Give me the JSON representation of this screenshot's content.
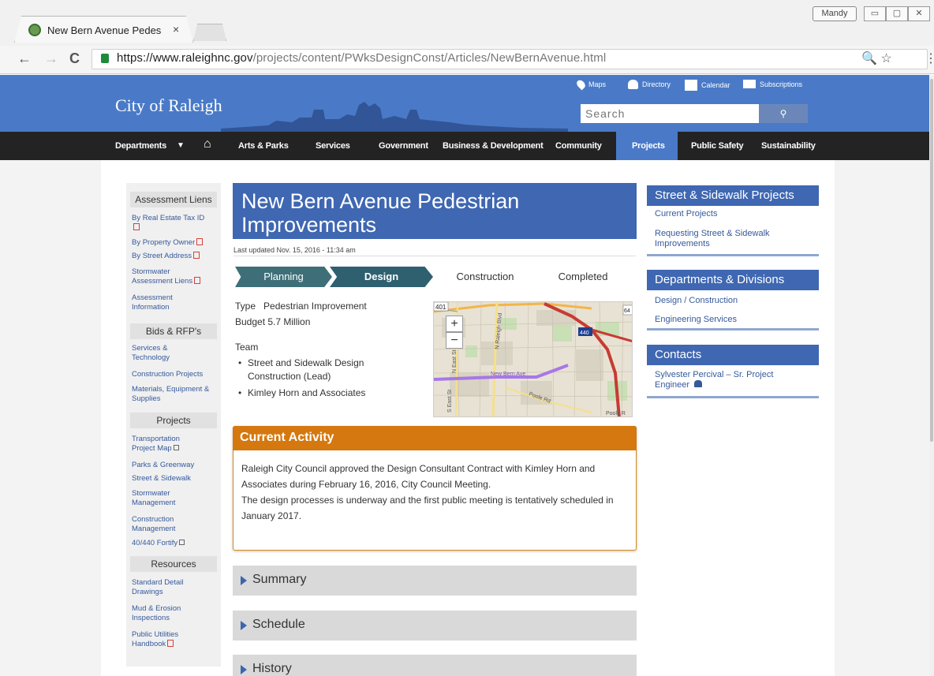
{
  "browser": {
    "tab_title": "New Bern Avenue Pedes",
    "tab_close": "×",
    "user": "Mandy",
    "url_host": "https://www.raleighnc.gov",
    "url_path": "/projects/content/PWksDesignConst/Articles/NewBernAvenue.html",
    "win_buttons": [
      "▭",
      "▢",
      "✕"
    ],
    "nav_back": "←",
    "nav_forward": "→",
    "nav_reload": "C",
    "url_icons": "🔍 ☆",
    "menu": "⋮"
  },
  "site": {
    "logo": "City of Raleigh",
    "util_links": [
      "Maps",
      "Directory",
      "Calendar",
      "Subscriptions"
    ],
    "search_placeholder": "Search",
    "search_icon": "⚲"
  },
  "nav": {
    "departments": "Departments",
    "caret": "▼",
    "home_icon": "⌂",
    "items": [
      "Arts & Parks",
      "Services",
      "Government",
      "Business & Development",
      "Community",
      "Projects",
      "Public Safety",
      "Sustainability"
    ]
  },
  "left_sidebar": {
    "sections": [
      {
        "heading": "Assessment Liens",
        "links": [
          "By Real Estate Tax ID",
          "By Property Owner",
          "By Street Address",
          "Stormwater Assessment Liens",
          "Assessment Information"
        ]
      },
      {
        "heading": "Bids & RFP's",
        "links": [
          "Services & Technology",
          "Construction Projects",
          "Materials, Equipment & Supplies"
        ]
      },
      {
        "heading": "Projects",
        "links": [
          "Transportation Project Map",
          "Parks & Greenway",
          "Street & Sidewalk",
          "Stormwater Management",
          "Construction Management",
          "40/440 Fortify"
        ]
      },
      {
        "heading": "Resources",
        "links": [
          "Standard Detail Drawings",
          "Mud & Erosion Inspections",
          "Public Utilities Handbook"
        ]
      }
    ]
  },
  "main": {
    "title": "New Bern Avenue Pedestrian Improvements",
    "updated": "Last updated Nov. 15, 2016 - 11:34 am",
    "steps": [
      "Planning",
      "Design",
      "Construction",
      "Completed"
    ],
    "active_step": "Design",
    "type_label": "Type",
    "type_value": "Pedestrian Improvement",
    "budget": "Budget 5.7 Million",
    "team_label": "Team",
    "team": [
      "Street and Sidewalk Design Construction (Lead)",
      "Kimley Horn and Associates"
    ],
    "map_zoom_in": "+",
    "map_zoom_out": "−",
    "map_labels": {
      "road1": "401",
      "road2": "440",
      "road3": "64",
      "street1": "N Raleigh Blvd",
      "street2": "N East St",
      "street3": "S East St",
      "street4": "New Bern Ave",
      "street5": "Poole Rd",
      "street6": "Poole R"
    },
    "activity_title": "Current Activity",
    "activity_text_1": "Raleigh City Council approved the Design Consultant Contract with Kimley Horn and Associates during February 16, 2016, City Council Meeting.",
    "activity_text_2": "The design processes is underway and the first public meeting is tentatively scheduled in January 2017.",
    "accordions": [
      "Summary",
      "Schedule",
      "History"
    ]
  },
  "right_sidebar": {
    "street_heading": "Street & Sidewalk Projects",
    "street_links": [
      "Current Projects",
      "Requesting Street & Sidewalk Improvements"
    ],
    "dept_heading": "Departments & Divisions",
    "dept_links": [
      "Design / Construction",
      "Engineering Services"
    ],
    "contacts_heading": "Contacts",
    "contact": "Sylvester Percival – Sr. Project Engineer"
  },
  "colors": {
    "brand_blue": "#3f67b2",
    "activity_orange": "#d4780f",
    "nav_dark": "#232323"
  }
}
